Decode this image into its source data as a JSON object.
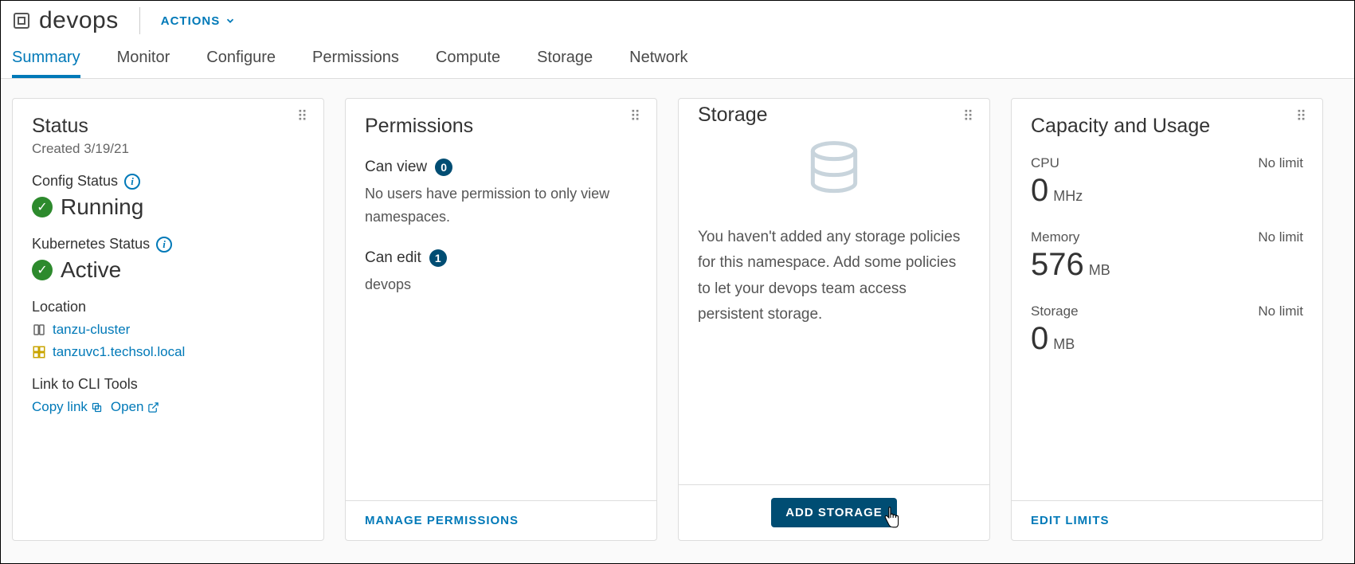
{
  "header": {
    "title": "devops",
    "actions_label": "ACTIONS"
  },
  "tabs": [
    "Summary",
    "Monitor",
    "Configure",
    "Permissions",
    "Compute",
    "Storage",
    "Network"
  ],
  "active_tab": "Summary",
  "status_card": {
    "title": "Status",
    "created": "Created 3/19/21",
    "config_label": "Config Status",
    "config_value": "Running",
    "k8s_label": "Kubernetes Status",
    "k8s_value": "Active",
    "location_label": "Location",
    "loc_cluster": "tanzu-cluster",
    "loc_vcenter": "tanzuvc1.techsol.local",
    "cli_label": "Link to CLI Tools",
    "copy_link": "Copy link",
    "open": "Open"
  },
  "permissions_card": {
    "title": "Permissions",
    "can_view_label": "Can view",
    "can_view_count": "0",
    "can_view_desc": "No users have permission to only view namespaces.",
    "can_edit_label": "Can edit",
    "can_edit_count": "1",
    "can_edit_user": "devops",
    "footer": "MANAGE PERMISSIONS"
  },
  "storage_card": {
    "title": "Storage",
    "desc": "You haven't added any storage policies for this namespace. Add some policies to let your devops team access persistent storage.",
    "footer": "ADD STORAGE"
  },
  "capacity_card": {
    "title": "Capacity and Usage",
    "cpu_label": "CPU",
    "cpu_limit": "No limit",
    "cpu_value": "0",
    "cpu_unit": "MHz",
    "mem_label": "Memory",
    "mem_limit": "No limit",
    "mem_value": "576",
    "mem_unit": "MB",
    "storage_label": "Storage",
    "storage_limit": "No limit",
    "storage_value": "0",
    "storage_unit": "MB",
    "footer": "EDIT LIMITS"
  }
}
